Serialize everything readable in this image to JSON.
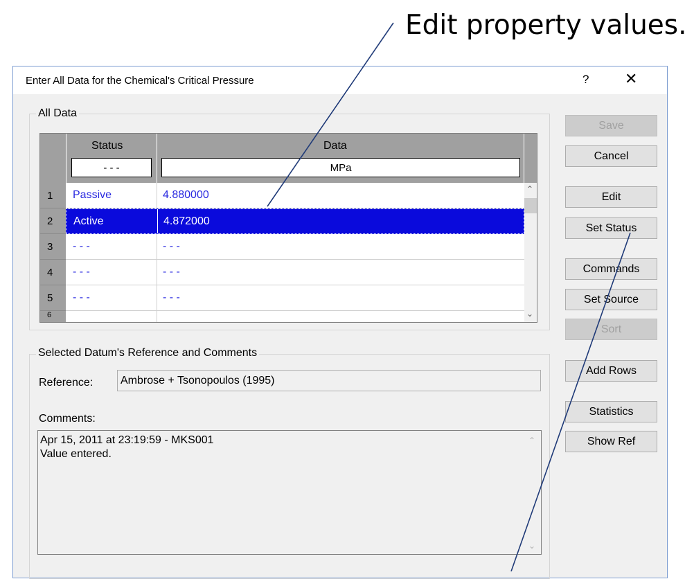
{
  "callouts": {
    "edit_property_values": "Edit property values."
  },
  "window": {
    "title": "Enter All Data for the Chemical's Critical Pressure",
    "help_glyph": "?",
    "close_glyph": "✕"
  },
  "all_data": {
    "group_label": "All Data",
    "columns": [
      "Status",
      "Data"
    ],
    "filters": [
      "- - -",
      "MPa"
    ],
    "rows": [
      {
        "num": "1",
        "status": "Passive",
        "data": "4.880000",
        "selected": false
      },
      {
        "num": "2",
        "status": "Active",
        "data": "4.872000",
        "selected": true
      },
      {
        "num": "3",
        "status": "- - -",
        "data": "- - -",
        "selected": false
      },
      {
        "num": "4",
        "status": "- - -",
        "data": "- - -",
        "selected": false
      },
      {
        "num": "5",
        "status": "- - -",
        "data": "- - -",
        "selected": false
      },
      {
        "num": "6",
        "status": "",
        "data": "",
        "selected": false
      }
    ]
  },
  "reference_section": {
    "group_label": "Selected Datum's Reference and Comments",
    "reference_label": "Reference:",
    "reference_value": "Ambrose + Tsonopoulos (1995)",
    "comments_label": "Comments:",
    "comments_line1": "Apr 15, 2011 at 23:19:59 - MKS001",
    "comments_line2": "Value entered."
  },
  "buttons": {
    "save": "Save",
    "cancel": "Cancel",
    "edit": "Edit",
    "set_status": "Set Status",
    "commands": "Commands",
    "set_source": "Set Source",
    "sort": "Sort",
    "add_rows": "Add Rows",
    "statistics": "Statistics",
    "show_ref": "Show Ref"
  },
  "colors": {
    "selection": "#0a0adc",
    "link_text": "#2a2ae0",
    "header_gray": "#a0a0a0",
    "callout_line": "#1f3a78"
  }
}
